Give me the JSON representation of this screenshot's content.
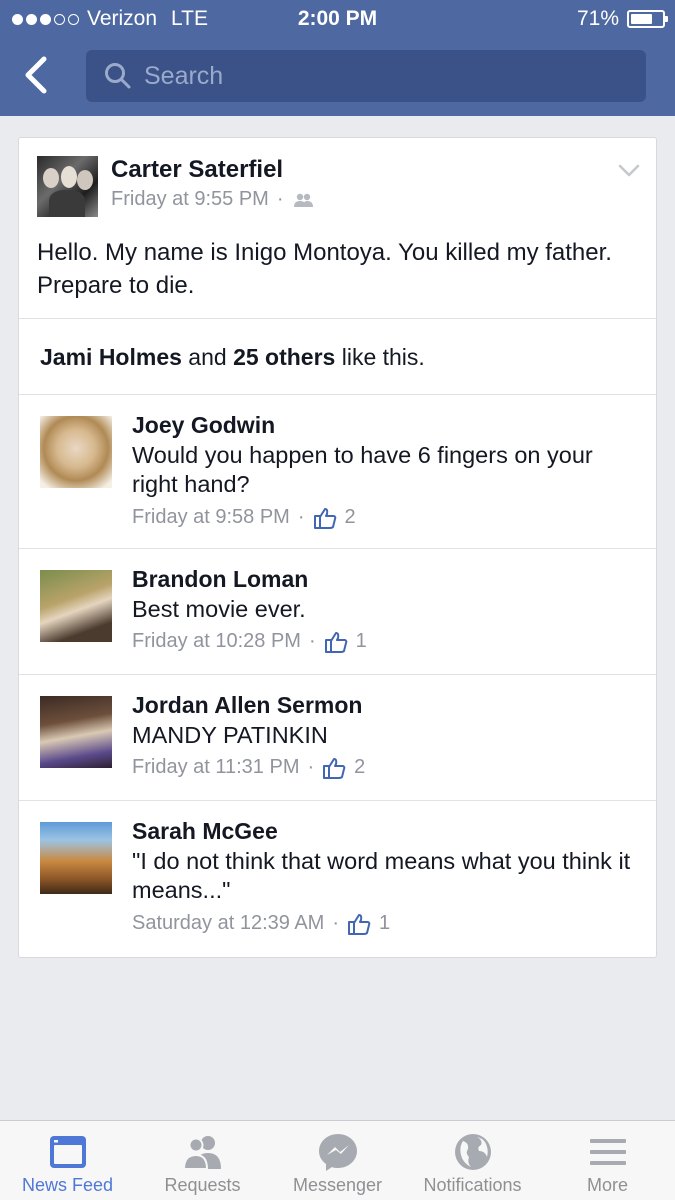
{
  "status_bar": {
    "carrier": "Verizon",
    "network": "LTE",
    "time": "2:00 PM",
    "battery": "71%",
    "battery_level": 0.71
  },
  "nav": {
    "search_placeholder": "Search"
  },
  "post": {
    "author": "Carter Saterfiel",
    "timestamp": "Friday at 9:55 PM",
    "separator": "·",
    "audience_icon": "friends-icon",
    "body": "Hello. My name is Inigo Montoya. You killed my father. Prepare to die.",
    "likes": {
      "name": "Jami Holmes",
      "and": "and",
      "others": "25 others",
      "suffix": "like this."
    }
  },
  "comments": [
    {
      "author": "Joey Godwin",
      "text": "Would you happen to have 6 fingers on your right hand?",
      "timestamp": "Friday at 9:58 PM",
      "likes": "2"
    },
    {
      "author": "Brandon Loman",
      "text": "Best movie ever.",
      "timestamp": "Friday at 10:28 PM",
      "likes": "1"
    },
    {
      "author": "Jordan Allen Sermon",
      "text": "MANDY PATINKIN",
      "timestamp": "Friday at 11:31 PM",
      "likes": "2"
    },
    {
      "author": "Sarah McGee",
      "text": "\"I do not think that word means what you think it means...\"",
      "timestamp": "Saturday at 12:39 AM",
      "likes": "1"
    }
  ],
  "tabbar": [
    {
      "label": "News Feed",
      "icon": "news-feed-icon",
      "active": true
    },
    {
      "label": "Requests",
      "icon": "requests-icon",
      "active": false
    },
    {
      "label": "Messenger",
      "icon": "messenger-icon",
      "active": false
    },
    {
      "label": "Notifications",
      "icon": "globe-icon",
      "active": false
    },
    {
      "label": "More",
      "icon": "menu-icon",
      "active": false
    }
  ],
  "colors": {
    "header_bg": "#4e69a2",
    "search_bg": "#3b5288",
    "page_bg": "#e9ebee",
    "meta_text": "#90949c",
    "like_blue": "#4267b2",
    "active_tab": "#4f78d6"
  }
}
